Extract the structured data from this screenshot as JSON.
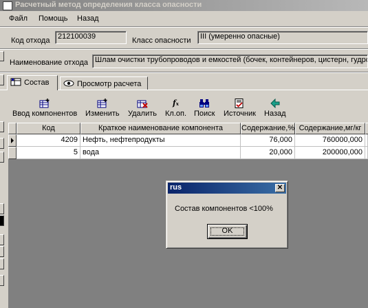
{
  "window": {
    "title": "Расчетный метод определения класса опасности"
  },
  "menu": [
    "Файл",
    "Помощь",
    "Назад"
  ],
  "fields": {
    "waste_code_label": "Код отхода",
    "waste_code_value": "212100039",
    "hazard_class_label": "Класс опасности",
    "hazard_class_value": "III (умеренно опасные)",
    "waste_name_label": "Наименование отхода",
    "waste_name_value": "Шлам очистки трубопроводов и емкостей (бочек, контейнеров, цистерн, гудро"
  },
  "tabs": [
    {
      "label": "Состав",
      "icon": "composition-icon"
    },
    {
      "label": "Просмотр расчета",
      "icon": "eye-icon"
    }
  ],
  "toolbar": [
    {
      "label": "Ввод компонентов",
      "icon": "table-add-icon"
    },
    {
      "label": "Изменить",
      "icon": "table-edit-icon"
    },
    {
      "label": "Удалить",
      "icon": "table-delete-icon"
    },
    {
      "label": "Кл.оп.",
      "icon": "function-icon"
    },
    {
      "label": "Поиск",
      "icon": "binoculars-icon"
    },
    {
      "label": "Источник",
      "icon": "document-check-icon"
    },
    {
      "label": "Назад",
      "icon": "arrow-left-icon"
    }
  ],
  "grid": {
    "columns": [
      "Код",
      "Краткое наименование компонента",
      "Содержание,%",
      "Содержание,мг/кг"
    ],
    "rows": [
      [
        "4209",
        "Нефть, нефтепродукты",
        "76,000",
        "760000,000"
      ],
      [
        "5",
        "вода",
        "20,000",
        "200000,000"
      ]
    ]
  },
  "dialog": {
    "title": "rus",
    "message": "Состав компонентов <100%",
    "ok_label": "OK",
    "close_glyph": "✕"
  }
}
